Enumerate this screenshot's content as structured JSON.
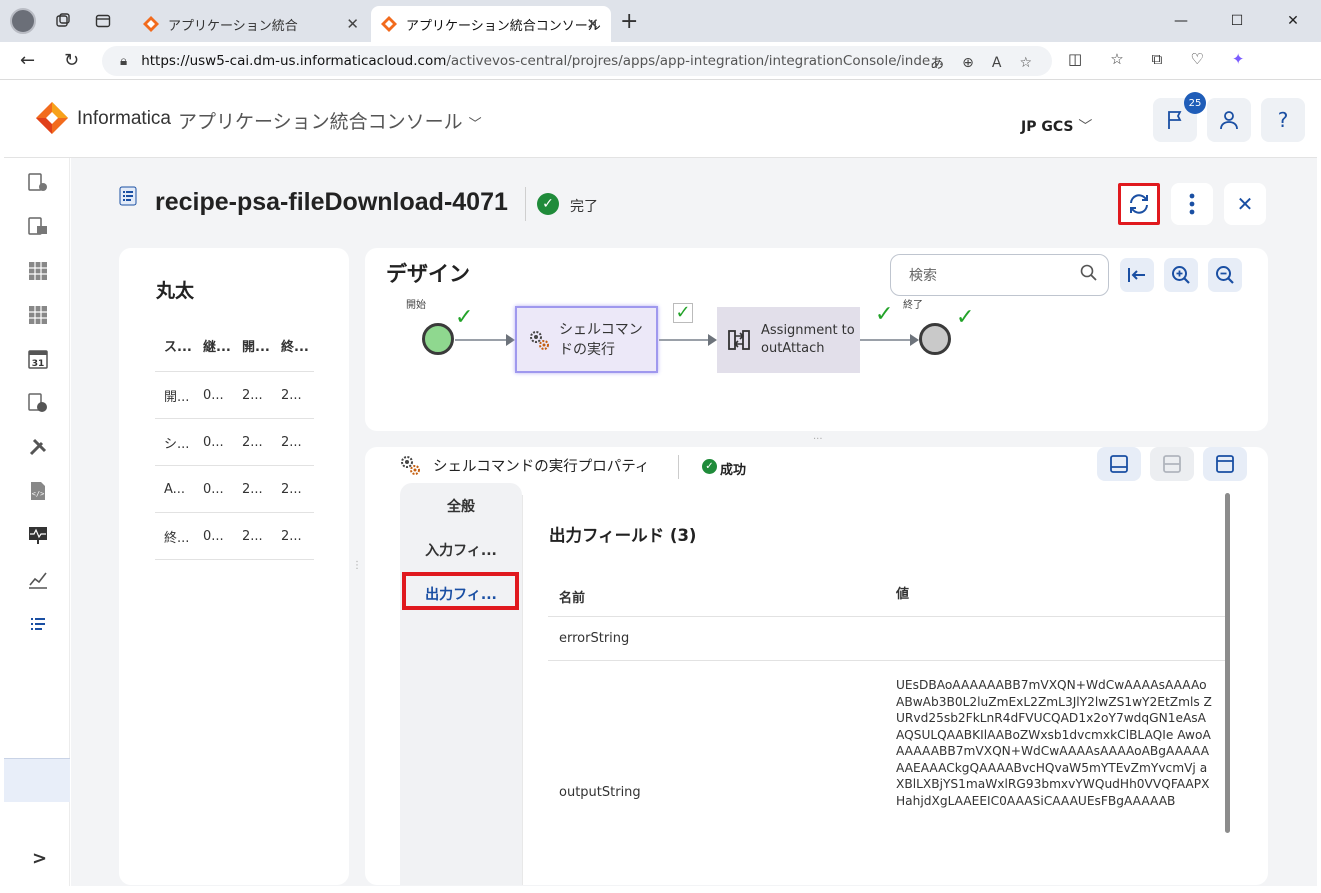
{
  "browser": {
    "tabs": [
      {
        "title": "アプリケーション統合"
      },
      {
        "title": "アプリケーション統合コンソール"
      }
    ],
    "url_host": "https://usw5-cai.dm-us.informaticacloud.com",
    "url_path": "/activevos-central/projres/apps/app-integration/integrationConsole/inde..."
  },
  "header": {
    "brand": "Informatica",
    "app_title": "アプリケーション統合コンソール",
    "org": "JP GCS",
    "notif_count": "25"
  },
  "page": {
    "title": "recipe-psa-fileDownload-4071",
    "status": "完了"
  },
  "steps_panel": {
    "title": "丸太",
    "columns": [
      "ス...",
      "継...",
      "開...",
      "終..."
    ],
    "rows": [
      [
        "開...",
        "0...",
        "2...",
        "2..."
      ],
      [
        "シ...",
        "0...",
        "2...",
        "2..."
      ],
      [
        "A...",
        "0...",
        "2...",
        "2..."
      ],
      [
        "終...",
        "0...",
        "2...",
        "2..."
      ]
    ]
  },
  "design": {
    "title": "デザイン",
    "search_placeholder": "検索",
    "start_label": "開始",
    "end_label": "終了",
    "node1": "シェルコマンドの実行",
    "node2": "Assignment to outAttach"
  },
  "properties": {
    "header": "シェルコマンドの実行プロパティ",
    "status": "成功",
    "tabs": [
      "全般",
      "入力フィ...",
      "出力フィ..."
    ],
    "content_title": "出力フィールド (3)",
    "columns": [
      "名前",
      "値"
    ],
    "rows": [
      {
        "name": "errorString",
        "value": ""
      },
      {
        "name": "outputString",
        "value": "UEsDBAoAAAAAABB7mVXQN+WdCwAAAAsAAAAoABwAb3B0L2luZmExL2ZmL3JlY2lwZS1wY2EtZmls ZURvd25sb2FkLnR4dFVUCQAD1x2oY7wdqGN1eAsAAQSULQAABKIlAABoZWxsb1dvcmxkClBLAQIe AwoAAAAAABB7mVXQN+WdCwAAAAsAAAAoABgAAAAAAAEAAACkgQAAAABvcHQvaW5mYTEvZmYvcmVj aXBlLXBjYS1maWxlRG93bmxvYWQudHh0VVQFAAPXHahjdXgLAAEEIC0AAASiCAAAUEsFBgAAAAAB"
      }
    ]
  },
  "colors": {
    "accent": "#1a4fa3",
    "highlight": "#e0191e",
    "success": "#1f8b3a"
  }
}
